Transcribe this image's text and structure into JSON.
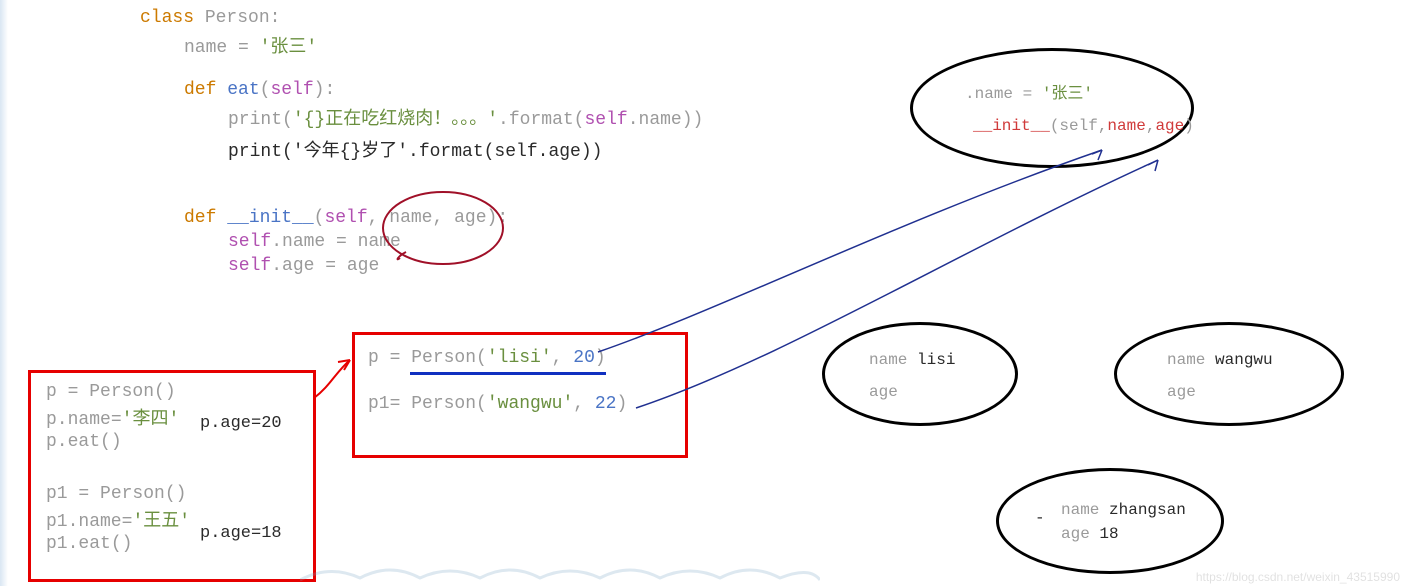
{
  "code": {
    "l1_class": "class ",
    "l1_person": "Person",
    "l1_colon": ":",
    "l2_name": "name ",
    "l2_eq": "= ",
    "l2_val": "'张三'",
    "l3_def": "def ",
    "l3_eat": "eat",
    "l3_open": "(",
    "l3_self": "self",
    "l3_close": "):",
    "l4a": "print",
    "l4b": "(",
    "l4c": "'{}正在吃红烧肉！。。。'",
    "l4d": ".",
    "l4e": "format",
    "l4f": "(",
    "l4g": "self",
    "l4h": ".",
    "l4i": "name",
    "l4j": "))",
    "l5": "print('今年{}岁了'.format(self.age))",
    "l6_def": "def ",
    "l6_init": "__init__",
    "l6_open": "(",
    "l6_self": "self",
    "l6_c1": ", ",
    "l6_name": "name",
    "l6_c2": ", ",
    "l6_age": "age",
    "l6_close": "):",
    "l7a": "self",
    "l7b": ".",
    "l7c": "name ",
    "l7d": "= ",
    "l7e": "name",
    "l8a": "self",
    "l8b": ".",
    "l8c": "age ",
    "l8d": "= ",
    "l8e": "age"
  },
  "box1": {
    "r1a": "p = ",
    "r1b": "Person",
    "r1c": "()",
    "r2a": "p.",
    "r2b": "name",
    "r2c": "=",
    "r2d": "'李四'",
    "r3a": "p.",
    "r3b": "eat",
    "r3c": "()",
    "note1": "p.age=20",
    "r4a": "p1 = ",
    "r4b": "Person",
    "r4c": "()",
    "r5a": "p1.",
    "r5b": "name",
    "r5c": "=",
    "r5d": "'王五'",
    "r6a": "p1.",
    "r6b": "eat",
    "r6c": "()",
    "note2": "p.age=18"
  },
  "box2": {
    "r1a": "p = ",
    "r1b": "Person",
    "r1c": "(",
    "r1d": "'lisi'",
    "r1e": ", ",
    "r1f": "20",
    "r1g": ")",
    "r2a": "p1= ",
    "r2b": "Person",
    "r2c": "(",
    "r2d": "'wangwu'",
    "r2e": ", ",
    "r2f": "22",
    "r2g": ")"
  },
  "bubbles": {
    "top": {
      "l1a": ".",
      "l1b": "name ",
      "l1c": "= ",
      "l1d": "'张三'",
      "l2a": "__init__",
      "l2b": "(self,",
      "l2c": "name",
      "l2d": ",",
      "l2e": "age",
      "l2f": ")"
    },
    "left": {
      "l1a": "name ",
      "l1b": "lisi",
      "l2": "age"
    },
    "right": {
      "l1a": "name ",
      "l1b": "wangwu",
      "l2": "age"
    },
    "bottom": {
      "l1a": "name ",
      "l1b": "zhangsan",
      "l2a": "age ",
      "l2b": "18",
      "dash": "-"
    }
  },
  "watermark": "https://blog.csdn.net/weixin_43515990",
  "colors": {
    "red": "#e60000",
    "darkred": "#a01028",
    "navy": "#203090"
  }
}
